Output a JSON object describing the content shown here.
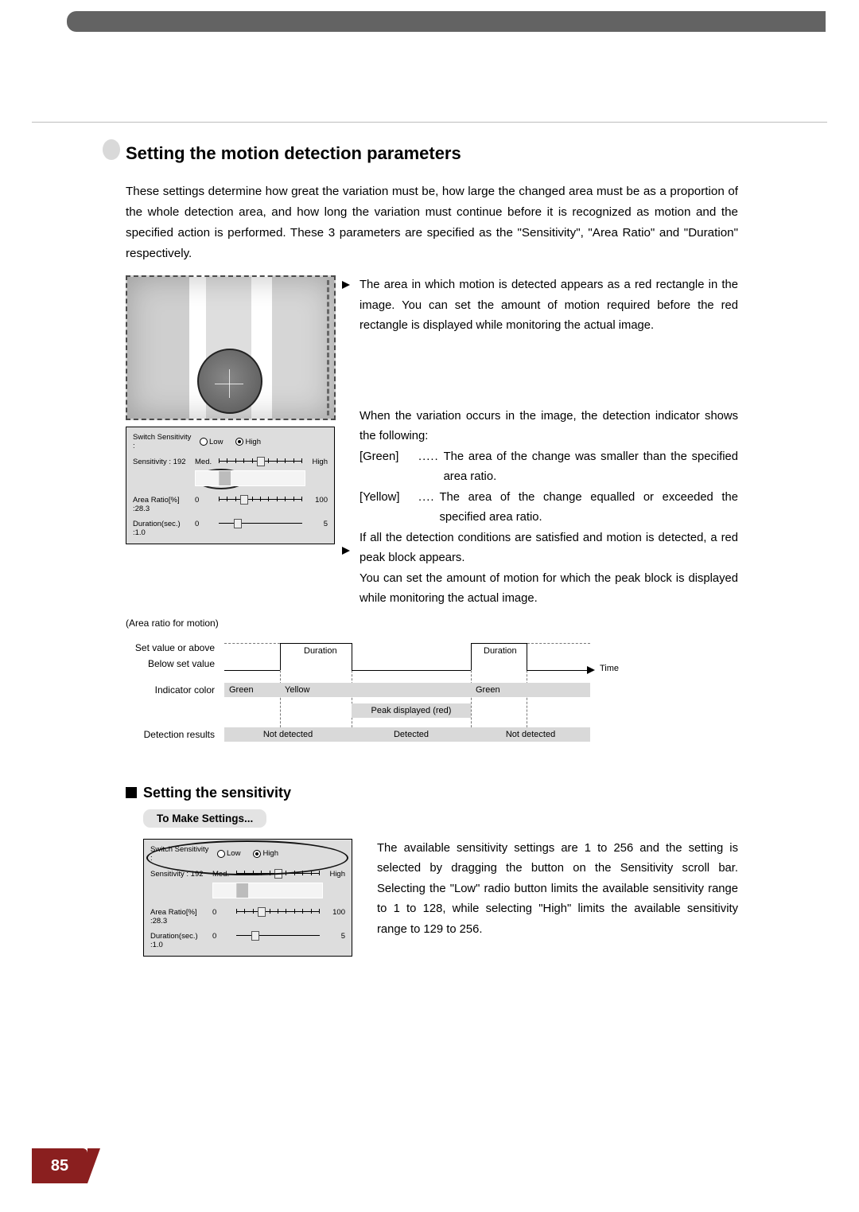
{
  "page_number": "85",
  "section_title": "Setting the motion detection parameters",
  "intro_paragraph": "These settings determine how great the variation must be, how large the changed area must be as a proportion of the whole detection area, and how long the variation must continue before it is recognized as motion and the specified action is performed. These 3 parameters are specified as the \"Sensitivity\", \"Area Ratio\" and \"Duration\" respectively.",
  "red_rect_paragraph": "The area in which motion is detected appears as a red rectangle in the image. You can set the amount of motion required before the red rectangle is displayed while monitoring the actual image.",
  "indicator_intro": "When the variation occurs in the image, the detection indicator shows the following:",
  "indicator_green_key": "[Green]",
  "indicator_green_val": "The area of the change was smaller than the specified area ratio.",
  "indicator_yellow_key": "[Yellow]",
  "indicator_yellow_val": "The area of the change equalled or exceeded the specified area ratio.",
  "peak_paragraph_1": "If all the detection conditions are satisfied and motion is detected, a red peak block appears.",
  "peak_paragraph_2": "You can set the amount of motion for which the peak block is displayed while monitoring the actual image.",
  "panel": {
    "switch_label": "Switch Sensitivity :",
    "radio_low": "Low",
    "radio_high": "High",
    "sens_label": "Sensitivity : 192",
    "sens_min": "Med.",
    "sens_max": "High",
    "area_label": "Area Ratio[%] :28.3",
    "area_min": "0",
    "area_max": "100",
    "dur_label": "Duration(sec.) :1.0",
    "dur_min": "0",
    "dur_max": "5"
  },
  "panel2": {
    "switch_label": "Switch Sensitivity :",
    "radio_low": "Low",
    "radio_high": "High",
    "sens_label": "Sensitivity : 192",
    "sens_min": "Med.",
    "sens_max": "High",
    "area_label": "Area Ratio[%] :28.3",
    "area_min": "0",
    "area_max": "100",
    "dur_label": "Duration(sec.) :1.0",
    "dur_min": "0",
    "dur_max": "5"
  },
  "timing": {
    "y_axis_title": "(Area ratio for motion)",
    "row_set_above": "Set value or above",
    "row_below": "Below set value",
    "time_label": "Time",
    "duration_label_1": "Duration",
    "duration_label_2": "Duration",
    "indicator_row_label": "Indicator color",
    "indicator_green_1": "Green",
    "indicator_yellow": "Yellow",
    "indicator_green_2": "Green",
    "peak_label": "Peak displayed (red)",
    "results_row_label": "Detection results",
    "result_not_detected_1": "Not detected",
    "result_detected": "Detected",
    "result_not_detected_2": "Not detected"
  },
  "sub_heading": "Setting the sensitivity",
  "to_make_settings": "To Make Settings...",
  "sensitivity_paragraph": "The available sensitivity settings are 1 to 256 and the setting is selected by dragging the button on the Sensitivity scroll bar. Selecting the \"Low\" radio button limits the available sensitivity range to 1 to 128, while selecting \"High\" limits the available sensitivity range to 129 to 256.",
  "chart_data": {
    "type": "step/timeline",
    "y_axis": "Area ratio for motion",
    "y_levels": [
      "Below set value",
      "Set value or above"
    ],
    "x_axis": "Time",
    "segments": [
      {
        "level": "Below set value",
        "indicator": "Green",
        "detection": "Not detected"
      },
      {
        "level": "Set value or above",
        "duration_label": "Duration",
        "indicator": "Yellow",
        "detection": "Detected",
        "peak": "Peak displayed (red)"
      },
      {
        "level": "Below set value"
      },
      {
        "level": "Set value or above",
        "duration_label": "Duration",
        "indicator": "Green",
        "detection": "Not detected"
      },
      {
        "level": "Below set value"
      }
    ]
  }
}
